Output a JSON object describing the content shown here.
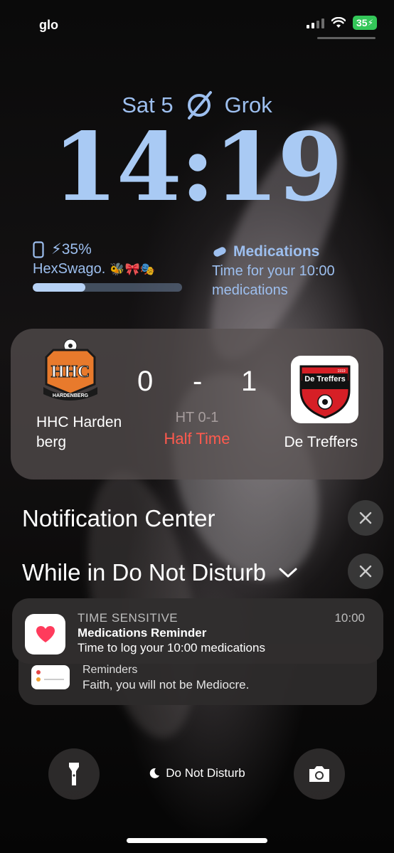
{
  "status_bar": {
    "carrier": "glo",
    "battery": "35"
  },
  "lock": {
    "date": "Sat 5",
    "focus_name": "Grok",
    "time": "14:19"
  },
  "widgets": {
    "battery": {
      "percent_label": "35%",
      "device_name": "HexSwago.",
      "level": 0.35
    },
    "medications": {
      "title": "Medications",
      "body": "Time for your 10:00 medications"
    }
  },
  "live_activity": {
    "home_team": "HHC Hardenberg",
    "home_logo_text": "HHC",
    "home_logo_sub": "HARDENBERG",
    "home_score": "0",
    "separator": "-",
    "away_score": "1",
    "away_team": "De Treffers",
    "away_logo_text": "De Treffers",
    "away_logo_year": "1919",
    "half_time_score": "HT 0-1",
    "status": "Half Time"
  },
  "notification_center": {
    "title": "Notification Center",
    "dnd_group": "While in Do Not Disturb"
  },
  "notifications": [
    {
      "label": "TIME SENSITIVE",
      "time": "10:00",
      "title": "Medications Reminder",
      "message": "Time to log your 10:00 medications"
    },
    {
      "app": "Reminders",
      "message": "Faith, you will not be Mediocre."
    }
  ],
  "bottom": {
    "focus_label": "Do Not Disturb"
  },
  "colors": {
    "accent": "#a9caf4",
    "half_time": "#ff5a4e",
    "battery": "#34c759"
  }
}
